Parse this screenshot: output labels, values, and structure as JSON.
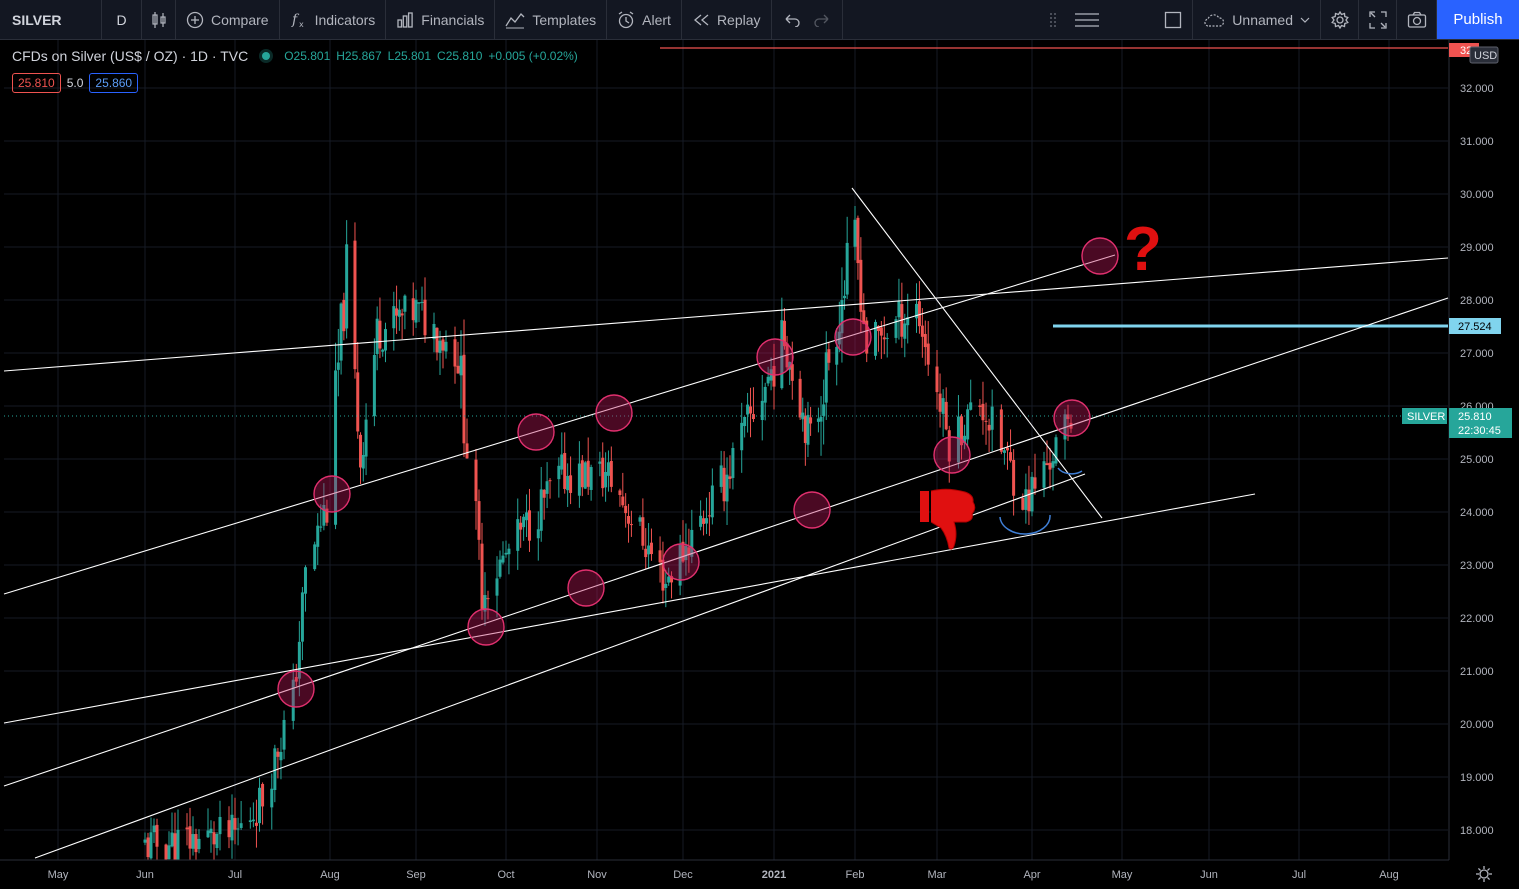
{
  "toolbar": {
    "symbol": "SILVER",
    "interval": "D",
    "compare": "Compare",
    "indicators": "Indicators",
    "financials": "Financials",
    "templates": "Templates",
    "alert": "Alert",
    "replay": "Replay",
    "layout_name": "Unnamed",
    "publish": "Publish"
  },
  "legend": {
    "title": "CFDs on Silver (US$ / OZ) · 1D · TVC",
    "open": "O25.801",
    "high": "H25.867",
    "low": "L25.801",
    "close": "C25.810",
    "change": "+0.005 (+0.02%)",
    "bid": "25.810",
    "spread": "5.0",
    "ask": "25.860"
  },
  "price_axis": {
    "currency": "USD",
    "top_clip": "32",
    "ticks": [
      "32.000",
      "31.000",
      "30.000",
      "29.000",
      "28.000",
      "27.000",
      "26.000",
      "25.000",
      "24.000",
      "23.000",
      "22.000",
      "21.000",
      "20.000",
      "19.000",
      "18.000"
    ],
    "last_symbol": "SILVER",
    "last_price": "25.810",
    "countdown": "22:30:45",
    "alert_level": "27.524"
  },
  "time_axis": {
    "ticks": [
      "May",
      "Jun",
      "Jul",
      "Aug",
      "Sep",
      "Oct",
      "Nov",
      "Dec",
      "2021",
      "Feb",
      "Mar",
      "Apr",
      "May",
      "Jun",
      "Jul",
      "Aug"
    ]
  },
  "annotations": {
    "question_mark": "?"
  },
  "colors": {
    "bull": "#26a69a",
    "bear": "#ef5350",
    "background": "#000000",
    "toolbar": "#131722",
    "accent": "#2962ff",
    "horizontal_line": "#80d4ee",
    "marker_circle": "#c2185b",
    "thumbs_down": "#e01010"
  },
  "chart_data": {
    "type": "candlestick",
    "title": "CFDs on Silver (US$ / OZ) · 1D · TVC",
    "ylim": [
      17.4,
      32.7
    ],
    "x": [
      "2020-05-01",
      "2020-06-01",
      "2020-07-01",
      "2020-08-01",
      "2020-09-01",
      "2020-10-01",
      "2020-11-01",
      "2020-12-01",
      "2021-01-01",
      "2021-02-01",
      "2021-03-01",
      "2021-04-01",
      "2021-05-01",
      "2021-06-01",
      "2021-07-01",
      "2021-08-01"
    ],
    "series": [
      {
        "values": [
          {
            "date": "2020-06-01",
            "close": 17.7
          },
          {
            "date": "2020-06-15",
            "close": 17.8
          },
          {
            "date": "2020-07-01",
            "close": 17.9
          },
          {
            "date": "2020-07-10",
            "close": 18.6
          },
          {
            "date": "2020-07-20",
            "close": 20.5
          },
          {
            "date": "2020-07-24",
            "close": 22.8
          },
          {
            "date": "2020-07-31",
            "close": 24.2
          },
          {
            "date": "2020-08-07",
            "close": 28.6
          },
          {
            "date": "2020-08-12",
            "close": 25.0
          },
          {
            "date": "2020-08-18",
            "close": 27.4
          },
          {
            "date": "2020-09-01",
            "close": 27.8
          },
          {
            "date": "2020-09-15",
            "close": 27.0
          },
          {
            "date": "2020-09-23",
            "close": 22.5
          },
          {
            "date": "2020-10-05",
            "close": 23.5
          },
          {
            "date": "2020-10-20",
            "close": 24.7
          },
          {
            "date": "2020-11-05",
            "close": 24.7
          },
          {
            "date": "2020-11-25",
            "close": 22.7
          },
          {
            "date": "2020-12-15",
            "close": 24.6
          },
          {
            "date": "2021-01-05",
            "close": 27.3
          },
          {
            "date": "2021-01-15",
            "close": 25.3
          },
          {
            "date": "2021-02-01",
            "close": 29.2
          },
          {
            "date": "2021-02-05",
            "close": 27.1
          },
          {
            "date": "2021-02-22",
            "close": 27.9
          },
          {
            "date": "2021-03-05",
            "close": 25.3
          },
          {
            "date": "2021-03-15",
            "close": 26.1
          },
          {
            "date": "2021-03-30",
            "close": 24.2
          },
          {
            "date": "2021-04-15",
            "close": 25.81
          }
        ]
      }
    ]
  }
}
